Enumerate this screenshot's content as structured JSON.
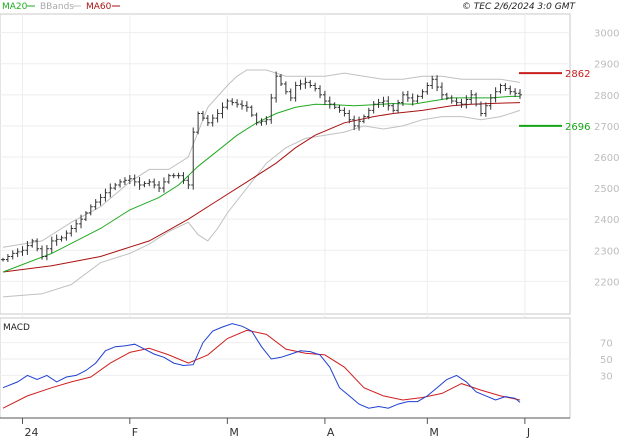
{
  "header": {
    "legend": [
      {
        "label": "MA20",
        "color": "#22aa22"
      },
      {
        "label": "BBands",
        "color": "#a8a8a8"
      },
      {
        "label": "MA60",
        "color": "#aa1111"
      }
    ],
    "copyright": "© TEC 2/6/2024 3:0 GMT"
  },
  "colors": {
    "price": "#333333",
    "ma20": "#22aa22",
    "ma60": "#aa1111",
    "bbands": "#c0c0c0",
    "macd": "#1f3fd0",
    "signal": "#d01f1f",
    "resistance": "#c81e1e",
    "support": "#16a416",
    "grid": "#eeeeee"
  },
  "chart_data": [
    {
      "type": "line",
      "title": "",
      "price_axis_ticks": [
        "3000",
        "2900",
        "2800",
        "2700",
        "2600",
        "2500",
        "2400",
        "2300",
        "2200"
      ],
      "price_axis_values": [
        3000,
        2900,
        2800,
        2700,
        2600,
        2500,
        2400,
        2300,
        2200
      ],
      "ylim": [
        2095,
        3060
      ],
      "xlim": [
        0,
        117
      ],
      "x_ticks": [
        {
          "label": "24",
          "x": 4
        },
        {
          "label": "F",
          "x": 26
        },
        {
          "label": "M",
          "x": 46
        },
        {
          "label": "A",
          "x": 66
        },
        {
          "label": "M",
          "x": 87
        },
        {
          "label": "J",
          "x": 107
        }
      ],
      "levels": [
        {
          "label": "2862",
          "value": 2870,
          "color": "#c81e1e"
        },
        {
          "label": "2696",
          "value": 2700,
          "color": "#16a416"
        }
      ],
      "series": [
        {
          "key": "close",
          "x": [
            0,
            2,
            4,
            6,
            8,
            10,
            12,
            14,
            16,
            18,
            20,
            22,
            24,
            26,
            28,
            30,
            32,
            34,
            36,
            38,
            39,
            40,
            42,
            44,
            46,
            48,
            50,
            52,
            54,
            56,
            58,
            59,
            60,
            62,
            64,
            66,
            68,
            70,
            72,
            74,
            76,
            78,
            80,
            82,
            84,
            86,
            88,
            90,
            92,
            94,
            96,
            98,
            100,
            102,
            104,
            106
          ],
          "y": [
            2270,
            2290,
            2300,
            2330,
            2280,
            2330,
            2340,
            2370,
            2400,
            2440,
            2470,
            2500,
            2520,
            2530,
            2510,
            2520,
            2500,
            2540,
            2540,
            2510,
            2680,
            2740,
            2710,
            2740,
            2780,
            2770,
            2760,
            2710,
            2720,
            2860,
            2810,
            2790,
            2830,
            2840,
            2820,
            2780,
            2760,
            2740,
            2700,
            2730,
            2770,
            2780,
            2750,
            2800,
            2780,
            2810,
            2850,
            2800,
            2780,
            2770,
            2800,
            2740,
            2790,
            2830,
            2810,
            2800
          ]
        },
        {
          "key": "ma20",
          "x": [
            0,
            10,
            20,
            26,
            32,
            36,
            40,
            44,
            48,
            52,
            56,
            60,
            64,
            68,
            72,
            76,
            80,
            84,
            88,
            92,
            96,
            100,
            104,
            106
          ],
          "y": [
            2230,
            2290,
            2370,
            2430,
            2470,
            2510,
            2570,
            2620,
            2670,
            2710,
            2740,
            2760,
            2770,
            2768,
            2765,
            2768,
            2772,
            2770,
            2780,
            2790,
            2790,
            2790,
            2795,
            2795
          ]
        },
        {
          "key": "ma60",
          "x": [
            0,
            10,
            20,
            30,
            38,
            44,
            50,
            56,
            60,
            64,
            70,
            76,
            80,
            86,
            92,
            96,
            100,
            104,
            106
          ],
          "y": [
            2230,
            2250,
            2280,
            2330,
            2400,
            2460,
            2520,
            2580,
            2630,
            2670,
            2710,
            2730,
            2740,
            2750,
            2765,
            2770,
            2772,
            2774,
            2775
          ]
        },
        {
          "key": "bband_upper",
          "x": [
            0,
            8,
            14,
            20,
            26,
            30,
            34,
            38,
            42,
            46,
            48,
            50,
            54,
            58,
            62,
            66,
            70,
            74,
            78,
            82,
            86,
            90,
            94,
            98,
            102,
            106
          ],
          "y": [
            2310,
            2330,
            2390,
            2440,
            2520,
            2560,
            2560,
            2600,
            2760,
            2830,
            2860,
            2880,
            2880,
            2860,
            2860,
            2860,
            2870,
            2860,
            2850,
            2850,
            2860,
            2860,
            2850,
            2850,
            2850,
            2840
          ]
        },
        {
          "key": "bband_lower",
          "x": [
            0,
            8,
            14,
            20,
            26,
            30,
            34,
            38,
            40,
            42,
            44,
            46,
            48,
            50,
            52,
            54,
            58,
            62,
            66,
            70,
            74,
            78,
            82,
            86,
            90,
            94,
            98,
            102,
            106
          ],
          "y": [
            2150,
            2160,
            2190,
            2260,
            2290,
            2320,
            2360,
            2390,
            2350,
            2330,
            2370,
            2420,
            2460,
            2500,
            2540,
            2580,
            2630,
            2660,
            2670,
            2680,
            2700,
            2690,
            2700,
            2720,
            2730,
            2730,
            2720,
            2730,
            2750
          ]
        }
      ]
    },
    {
      "type": "line",
      "title": "MACD",
      "axis_ticks": [
        "70",
        "50",
        "30"
      ],
      "axis_values": [
        70,
        50,
        30
      ],
      "ylim": [
        -22,
        100
      ],
      "xlim": [
        0,
        117
      ],
      "series": [
        {
          "key": "macd",
          "x": [
            0,
            3,
            5,
            7,
            9,
            11,
            13,
            15,
            17,
            19,
            21,
            23,
            25,
            27,
            29,
            31,
            33,
            35,
            37,
            39,
            41,
            43,
            45,
            47,
            49,
            51,
            53,
            55,
            57,
            59,
            61,
            63,
            65,
            67,
            69,
            71,
            73,
            75,
            77,
            79,
            81,
            83,
            85,
            87,
            89,
            91,
            93,
            95,
            97,
            99,
            101,
            103,
            105,
            106
          ],
          "y": [
            15,
            22,
            30,
            25,
            30,
            22,
            28,
            30,
            36,
            45,
            60,
            65,
            66,
            68,
            62,
            56,
            52,
            45,
            42,
            43,
            70,
            84,
            89,
            93,
            90,
            84,
            65,
            50,
            52,
            56,
            60,
            59,
            55,
            40,
            15,
            5,
            -5,
            -10,
            -8,
            -10,
            -5,
            -2,
            -2,
            5,
            15,
            25,
            30,
            22,
            10,
            5,
            0,
            4,
            2,
            -3
          ]
        },
        {
          "key": "signal",
          "x": [
            0,
            5,
            10,
            14,
            18,
            22,
            26,
            30,
            34,
            38,
            42,
            46,
            50,
            54,
            58,
            62,
            66,
            70,
            74,
            78,
            82,
            86,
            90,
            94,
            98,
            102,
            106
          ],
          "y": [
            -10,
            5,
            15,
            22,
            28,
            45,
            58,
            63,
            55,
            45,
            55,
            75,
            85,
            80,
            62,
            57,
            55,
            40,
            15,
            5,
            0,
            3,
            8,
            20,
            12,
            5,
            0
          ]
        }
      ]
    }
  ]
}
